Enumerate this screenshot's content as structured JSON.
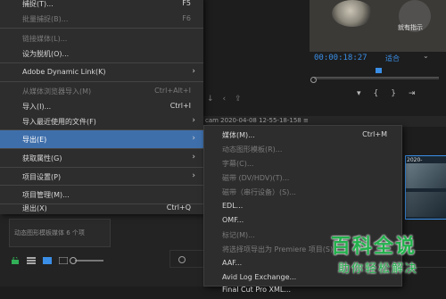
{
  "main_menu": {
    "items": [
      {
        "label": "捕捉(T)...",
        "shortcut": "F5"
      },
      {
        "label": "批量捕捉(B)...",
        "shortcut": "F6"
      },
      {
        "label": "链接媒体(L)..."
      },
      {
        "label": "设为脱机(O)..."
      },
      {
        "label": "Adobe Dynamic Link(K)"
      },
      {
        "label": "从媒体浏览器导入(M)",
        "shortcut": "Ctrl+Alt+I"
      },
      {
        "label": "导入(I)...",
        "shortcut": "Ctrl+I"
      },
      {
        "label": "导入最近使用的文件(F)"
      },
      {
        "label": "导出(E)"
      },
      {
        "label": "获取属性(G)"
      },
      {
        "label": "项目设置(P)"
      },
      {
        "label": "项目管理(M)..."
      },
      {
        "label": "退出(X)",
        "shortcut": "Ctrl+Q"
      }
    ]
  },
  "export_submenu": {
    "items": [
      {
        "label": "媒体(M)...",
        "shortcut": "Ctrl+M"
      },
      {
        "label": "动态图形模板(R)..."
      },
      {
        "label": "字幕(C)..."
      },
      {
        "label": "磁带 (DV/HDV)(T)..."
      },
      {
        "label": "磁带（串行设备）(S)..."
      },
      {
        "label": "EDL..."
      },
      {
        "label": "OMF..."
      },
      {
        "label": "标记(M)..."
      },
      {
        "label": "将选择项导出为 Premiere 项目(S)..."
      },
      {
        "label": "AAF..."
      },
      {
        "label": "Avid Log Exchange..."
      },
      {
        "label": "Final Cut Pro XML..."
      }
    ]
  },
  "background": {
    "timecode": "00:00:18:27",
    "fit_label": "适合",
    "zoom_label": "就有指示",
    "sequence_tab": "cam 2020-04-08 12-55-18-158  ≡",
    "panel_text": "动态图形模板媒体  6 个项",
    "thumb_label": "2020-"
  },
  "watermark": {
    "title": "百科全说",
    "subtitle": "助你轻松解决"
  },
  "colors": {
    "menu_bg": "#2d2d2d",
    "highlight": "#3f6fab",
    "accent_blue": "#3a8ee6",
    "watermark_green": "#22b14c"
  }
}
